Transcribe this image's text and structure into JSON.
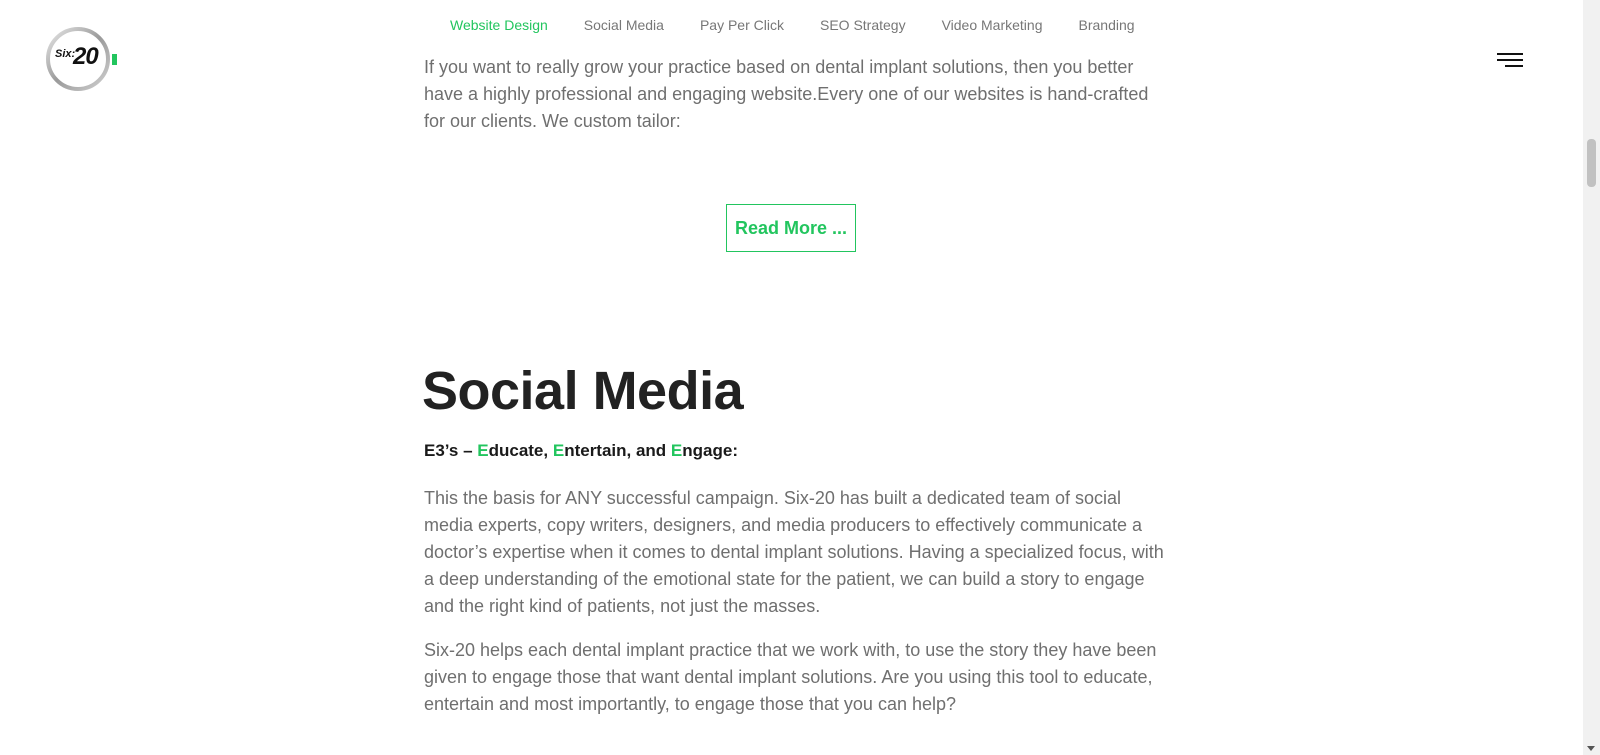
{
  "top_cutoff_text": "...",
  "logo": {
    "small_text": "Six:",
    "big_text": "20",
    "accent_color": "#22c55e"
  },
  "subnav": {
    "items": [
      {
        "label": "Website Design",
        "active": true
      },
      {
        "label": "Social Media",
        "active": false
      },
      {
        "label": "Pay Per Click",
        "active": false
      },
      {
        "label": "SEO Strategy",
        "active": false
      },
      {
        "label": "Video Marketing",
        "active": false
      },
      {
        "label": "Branding",
        "active": false
      }
    ]
  },
  "hamburger": {
    "icon": "menu-icon"
  },
  "website_design": {
    "paragraph": "If you want to really grow your practice based on dental implant solutions, then you better have a highly professional and engaging website.Every one of our websites is hand-crafted for our clients. We custom tailor:",
    "read_more_label": "Read More ..."
  },
  "social_media": {
    "heading": "Social Media",
    "subheading": {
      "prefix": "E3’s – ",
      "e1": "E",
      "w1": "ducate, ",
      "e2": "E",
      "w2": "ntertain, and ",
      "e3": "E",
      "w3": "ngage:"
    },
    "paragraph1": "This the basis for ANY successful campaign. Six-20 has built a dedicated team of social media experts, copy writers, designers, and media producers to effectively communicate a doctor’s expertise when it comes to dental implant solutions. Having a specialized focus, with a deep understanding of the emotional state for the patient, we can build a story to engage and the right kind of patients, not just the masses.",
    "paragraph2": "Six-20 helps each dental implant practice that we work with, to use the story they have been given to engage those that want dental implant solutions. Are you using this tool to educate, entertain and most importantly, to engage those that you can help?"
  },
  "colors": {
    "accent": "#22c55e",
    "heading": "#222222",
    "body_text": "#6f6f6f"
  }
}
